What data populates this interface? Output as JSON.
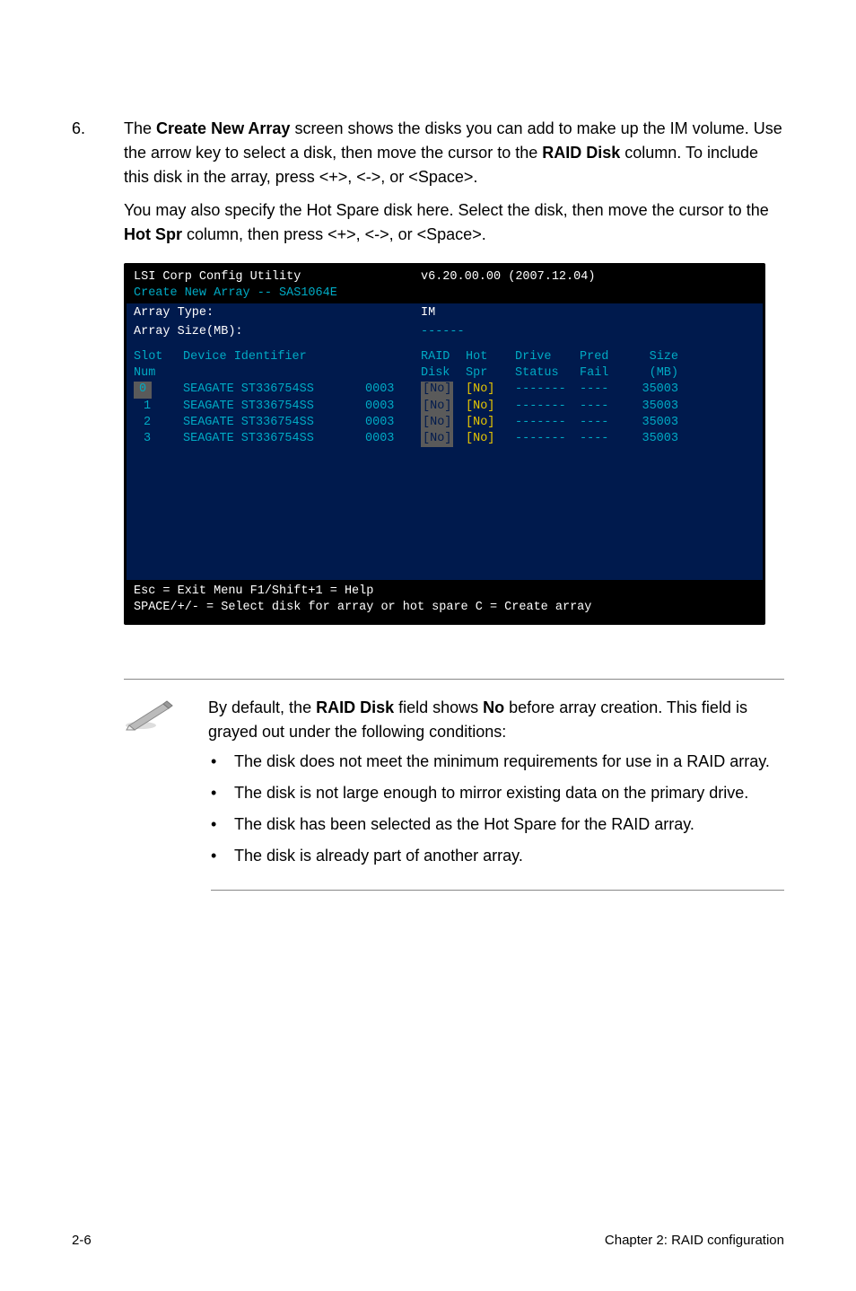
{
  "step": {
    "number": "6.",
    "text_part1": "The ",
    "text_bold1": "Create New Array",
    "text_part2": " screen shows the disks you can add to make up the IM volume. Use the arrow key to select a disk, then move the cursor to the ",
    "text_bold2": "RAID Disk",
    "text_part3": " column. To include this disk in the array, press <+>, <->, or <Space>.",
    "followup_part1": "You may also specify the Hot Spare disk here. Select the disk, then move the cursor to the ",
    "followup_bold": "Hot Spr",
    "followup_part2": " column, then press <+>, <->, or <Space>."
  },
  "terminal": {
    "title_left": "LSI Corp Config Utility",
    "title_right": "v6.20.00.00 (2007.12.04)",
    "subtitle": "Create New Array -- SAS1064E",
    "array_type_label": "Array Type:",
    "array_type_value": "IM",
    "array_size_label": "Array Size(MB):",
    "array_size_value": "------",
    "headers": {
      "slot": "Slot",
      "num": "Num",
      "device": "Device Identifier",
      "raid": "RAID",
      "disk": "Disk",
      "hot": "Hot",
      "spr": "Spr",
      "drive": "Drive",
      "status": "Status",
      "pred": "Pred",
      "fail": "Fail",
      "size": "Size",
      "mb": "(MB)"
    },
    "rows": [
      {
        "slot": "0",
        "device": "SEAGATE ST336754SS",
        "num": "0003",
        "raid": "[No]",
        "hot": "[No]",
        "drive": "-------",
        "pred": "----",
        "size": "35003",
        "highlight": true
      },
      {
        "slot": "1",
        "device": "SEAGATE ST336754SS",
        "num": "0003",
        "raid": "[No]",
        "hot": "[No]",
        "drive": "-------",
        "pred": "----",
        "size": "35003",
        "highlight": false
      },
      {
        "slot": "2",
        "device": "SEAGATE ST336754SS",
        "num": "0003",
        "raid": "[No]",
        "hot": "[No]",
        "drive": "-------",
        "pred": "----",
        "size": "35003",
        "highlight": false
      },
      {
        "slot": "3",
        "device": "SEAGATE ST336754SS",
        "num": "0003",
        "raid": "[No]",
        "hot": "[No]",
        "drive": "-------",
        "pred": "----",
        "size": "35003",
        "highlight": false
      }
    ],
    "footer_line1": "Esc = Exit Menu   F1/Shift+1 = Help",
    "footer_line2": "SPACE/+/- = Select disk for array or hot spare   C = Create array"
  },
  "note": {
    "intro_part1": "By default, the ",
    "intro_bold1": "RAID Disk",
    "intro_part2": " field shows ",
    "intro_bold2": "No",
    "intro_part3": " before array creation. This field is grayed out under the following conditions:",
    "items": [
      "The disk does not meet the minimum requirements for use in a RAID array.",
      "The disk is not large enough to mirror existing data on the primary drive.",
      "The disk has been selected as the Hot Spare for the RAID array.",
      "The disk is already part of another array."
    ]
  },
  "footer": {
    "left": "2-6",
    "right": "Chapter 2: RAID configuration"
  }
}
